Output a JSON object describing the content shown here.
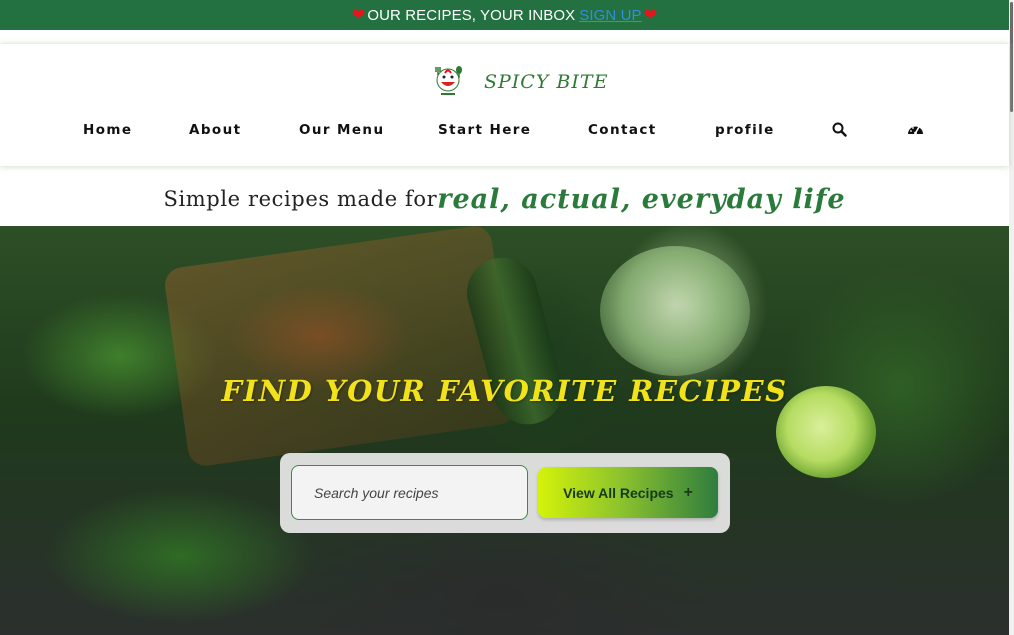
{
  "announcement": {
    "text": "OUR RECIPES, YOUR INBOX",
    "link_label": "SIGN UP",
    "left_icon": "heart-icon",
    "right_icon": "heart-icon"
  },
  "brand": {
    "name": "SPICY BITE",
    "logo_icon": "chef-smiley-logo"
  },
  "nav": {
    "items": [
      {
        "label": "Home"
      },
      {
        "label": "About"
      },
      {
        "label": "Our Menu"
      },
      {
        "label": "Start Here"
      },
      {
        "label": "Contact"
      },
      {
        "label": "profile"
      }
    ],
    "icons": [
      "search-icon",
      "dashboard-icon"
    ]
  },
  "tagline": {
    "plain": "Simple recipes made for",
    "accent": "real, actual, everyday life"
  },
  "hero": {
    "title": "FIND YOUR FAVORITE RECIPES",
    "search_placeholder": "Search your recipes",
    "button_label": "View All Recipes",
    "button_icon": "plus-icon"
  },
  "colors": {
    "topbar": "#237040",
    "brand_green": "#2e7a34",
    "hero_title": "#f2e21a",
    "link": "#2f8fe0",
    "heart": "#e8141c"
  }
}
